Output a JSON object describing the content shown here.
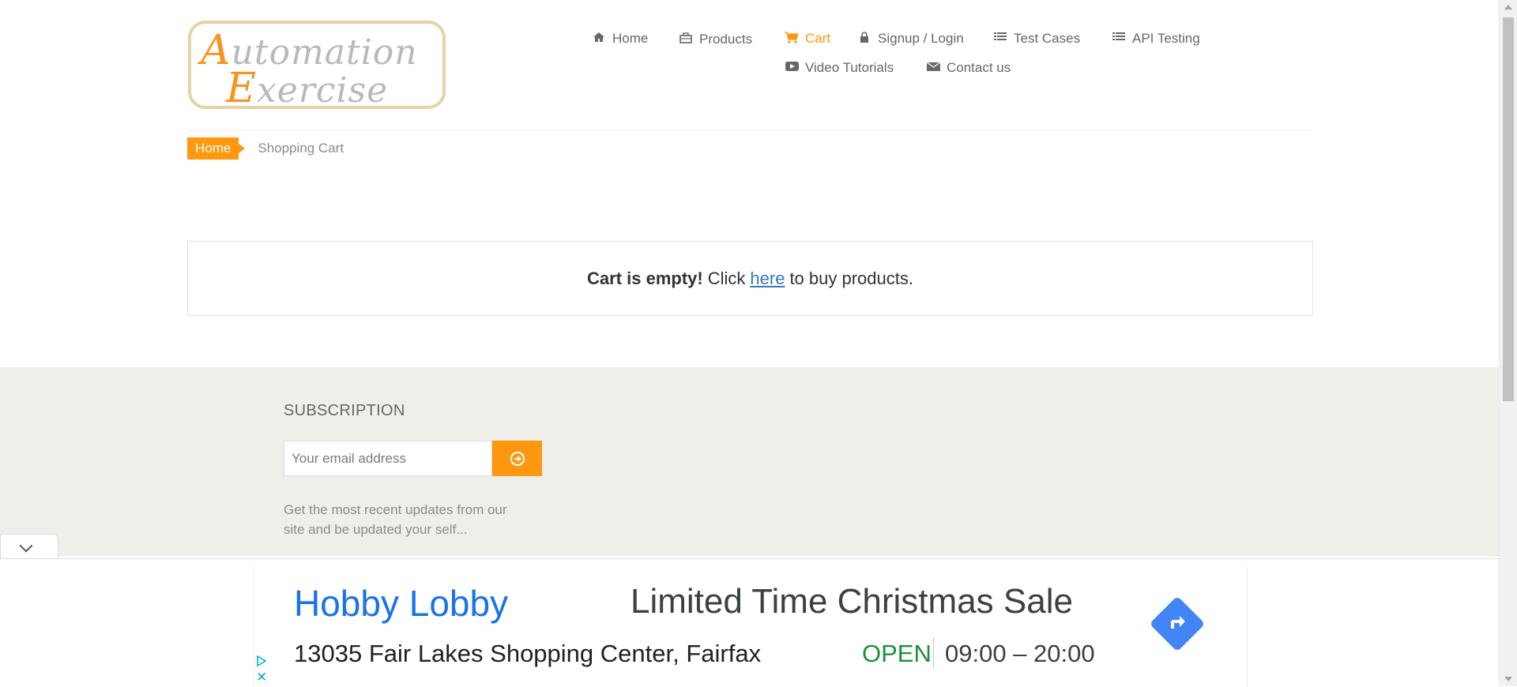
{
  "logo": {
    "line1_cap": "A",
    "line1_rest": "utomation",
    "line2_cap": "E",
    "line2_rest": "xercise"
  },
  "nav": {
    "items": [
      {
        "label": "Home",
        "icon": "home-icon"
      },
      {
        "label": "Products",
        "icon": "briefcase-icon"
      },
      {
        "label": "Cart",
        "icon": "cart-icon",
        "active": true
      },
      {
        "label": "Signup / Login",
        "icon": "lock-icon"
      },
      {
        "label": "Test Cases",
        "icon": "list-icon"
      },
      {
        "label": "API Testing",
        "icon": "list-icon"
      },
      {
        "label": "Video Tutorials",
        "icon": "youtube-play-icon"
      },
      {
        "label": "Contact us",
        "icon": "envelope-icon"
      }
    ]
  },
  "breadcrumb": {
    "home": "Home",
    "current": "Shopping Cart"
  },
  "cart": {
    "empty_bold": "Cart is empty!",
    "click": "Click",
    "link": "here",
    "tail": "to buy products."
  },
  "subscription": {
    "title": "SUBSCRIPTION",
    "placeholder": "Your email address",
    "description": "Get the most recent updates from our site and be updated your self..."
  },
  "ad": {
    "brand": "Hobby Lobby",
    "headline": "Limited Time Christmas Sale",
    "address": "13035 Fair Lakes Shopping Center, Fairfax",
    "status": "OPEN",
    "hours": "09:00 – 20:00"
  },
  "colors": {
    "accent": "#fe980f",
    "text": "#696763",
    "footer_bg": "#efefe9",
    "link": "#337ab7",
    "ad_blue": "#1a73e8",
    "open_green": "#1e8e3e"
  }
}
